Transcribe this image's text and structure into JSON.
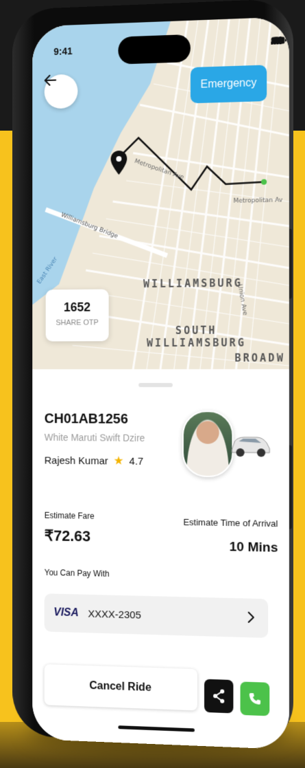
{
  "status_bar": {
    "time": "9:41"
  },
  "header": {
    "emergency_label": "Emergency"
  },
  "map": {
    "labels": {
      "metropolitan_ave_1": "Metropolitan Ave",
      "metropolitan_ave_2": "Metropolitan Av",
      "williamsburg_bridge": "Williamsburg Bridge",
      "east_river": "East River",
      "union_ave": "Union Ave",
      "williamsburg": "WILLIAMSBURG",
      "south_williamsburg": "SOUTH\nWILLIAMSBURG",
      "broadway": "BROADW"
    },
    "colors": {
      "water": "#a9d4ec",
      "land": "#efe8d8",
      "route": "#111111",
      "destination": "#4cc24a"
    }
  },
  "otp": {
    "code": "1652",
    "label": "SHARE OTP"
  },
  "ride": {
    "plate": "CH01AB1256",
    "car_model": "White Maruti Swift Dzire",
    "driver_name": "Rajesh Kumar",
    "rating": "4.7",
    "fare_label": "Estimate Fare",
    "fare_value": "₹72.63",
    "eta_label": "Estimate Time of Arrival",
    "eta_value": "10 Mins"
  },
  "payment": {
    "label": "You Can Pay With",
    "brand": "VISA",
    "card_number": "XXXX-2305"
  },
  "actions": {
    "cancel_label": "Cancel Ride"
  },
  "theme": {
    "accent_blue": "#2aa7e6",
    "call_green": "#4cc24a",
    "background_yellow": "#f7c21d",
    "star": "#f4b400"
  }
}
